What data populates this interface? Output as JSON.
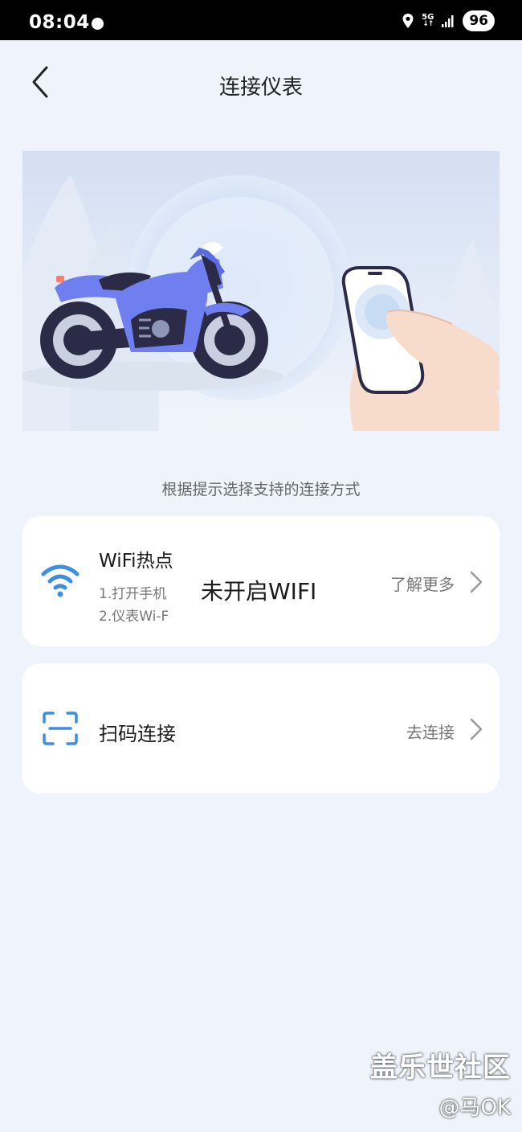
{
  "status_bar": {
    "time": "08:04",
    "network": "5G",
    "battery": "96"
  },
  "header": {
    "title": "连接仪表"
  },
  "hint": "根据提示选择支持的连接方式",
  "wifi_card": {
    "title": "WiFi热点",
    "step1": "1.打开手机",
    "step2": "2.仪表Wi-F",
    "toast": "未开启WIFI",
    "action": "了解更多"
  },
  "scan_card": {
    "title": "扫码连接",
    "action": "去连接"
  },
  "watermark": {
    "brand": "盖乐世社区",
    "user": "@马OK"
  },
  "colors": {
    "accent": "#3a8fe0",
    "background": "#eff3fb",
    "motorcycle": "#6f7ff0"
  },
  "icons": [
    "location-icon",
    "signal-icon",
    "back-icon",
    "wifi-icon",
    "scan-icon",
    "chevron-right-icon"
  ]
}
